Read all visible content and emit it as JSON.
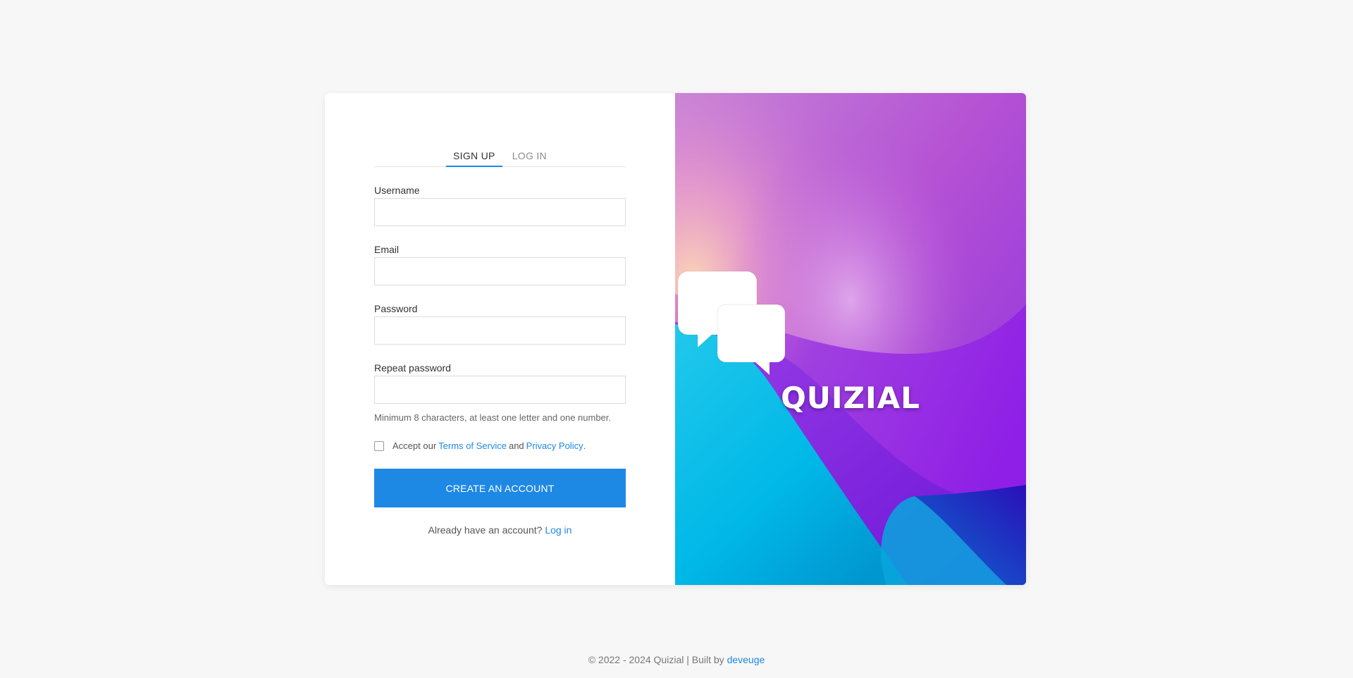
{
  "tabs": {
    "signup": "SIGN UP",
    "login": "LOG IN"
  },
  "form": {
    "username_label": "Username",
    "email_label": "Email",
    "password_label": "Password",
    "repeat_password_label": "Repeat password",
    "password_hint": "Minimum 8 characters, at least one letter and one number.",
    "terms_prefix": "Accept our",
    "terms_link": "Terms of Service",
    "terms_and": "and",
    "privacy_link": "Privacy Policy",
    "terms_suffix": ".",
    "submit_label": "CREATE AN ACCOUNT",
    "already_text": "Already have an account?",
    "login_link": "Log in"
  },
  "brand": {
    "name": "QUIZIAL",
    "icon": "chat-bubbles-icon"
  },
  "footer": {
    "copyright": "© 2022 - 2024 Quizial | Built by",
    "author_link": "deveuge"
  },
  "colors": {
    "accent": "#1e88e5",
    "background": "#f7f7f7"
  }
}
